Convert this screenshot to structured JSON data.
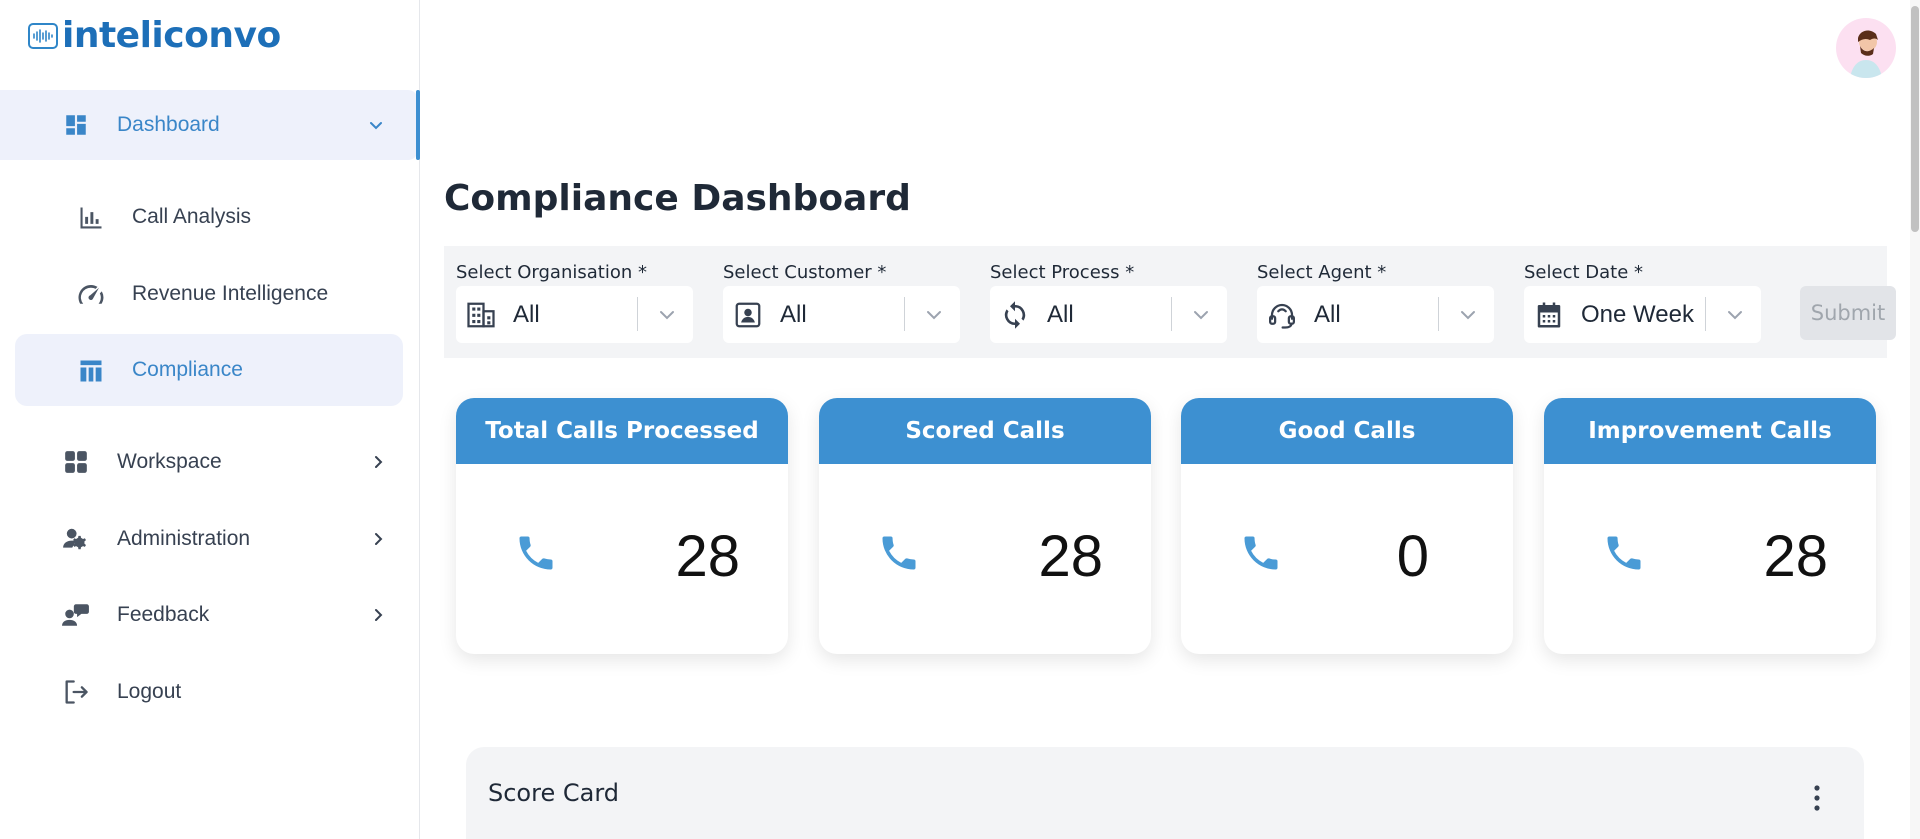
{
  "brand": {
    "name": "inteliconvo",
    "color": "#1d6fb8"
  },
  "sidebar": {
    "items": [
      {
        "label": "Dashboard",
        "icon": "dashboard-icon",
        "expanded": true
      },
      {
        "label": "Workspace",
        "icon": "grid-icon"
      },
      {
        "label": "Administration",
        "icon": "admin-user-icon"
      },
      {
        "label": "Feedback",
        "icon": "feedback-icon"
      },
      {
        "label": "Logout",
        "icon": "logout-icon"
      }
    ],
    "subitems": [
      {
        "label": "Call Analysis",
        "icon": "bar-chart-icon"
      },
      {
        "label": "Revenue Intelligence",
        "icon": "speedometer-icon"
      },
      {
        "label": "Compliance",
        "icon": "table-chart-icon",
        "active": true
      }
    ]
  },
  "page": {
    "title": "Compliance Dashboard"
  },
  "filters": [
    {
      "label": "Select Organisation *",
      "value": "All",
      "icon": "building-icon"
    },
    {
      "label": "Select Customer *",
      "value": "All",
      "icon": "contact-card-icon"
    },
    {
      "label": "Select Process *",
      "value": "All",
      "icon": "refresh-icon"
    },
    {
      "label": "Select Agent *",
      "value": "All",
      "icon": "headset-icon"
    },
    {
      "label": "Select Date *",
      "value": "One Week",
      "icon": "calendar-icon"
    }
  ],
  "submit_label": "Submit",
  "cards": [
    {
      "title": "Total Calls Processed",
      "value": "28"
    },
    {
      "title": "Scored Calls",
      "value": "28"
    },
    {
      "title": "Good Calls",
      "value": "0"
    },
    {
      "title": "Improvement Calls",
      "value": "28"
    }
  ],
  "scorecard": {
    "title": "Score Card"
  },
  "colors": {
    "accent": "#3d90d1",
    "active_bg": "#eef1fb",
    "phone": "#4a9bd6"
  }
}
